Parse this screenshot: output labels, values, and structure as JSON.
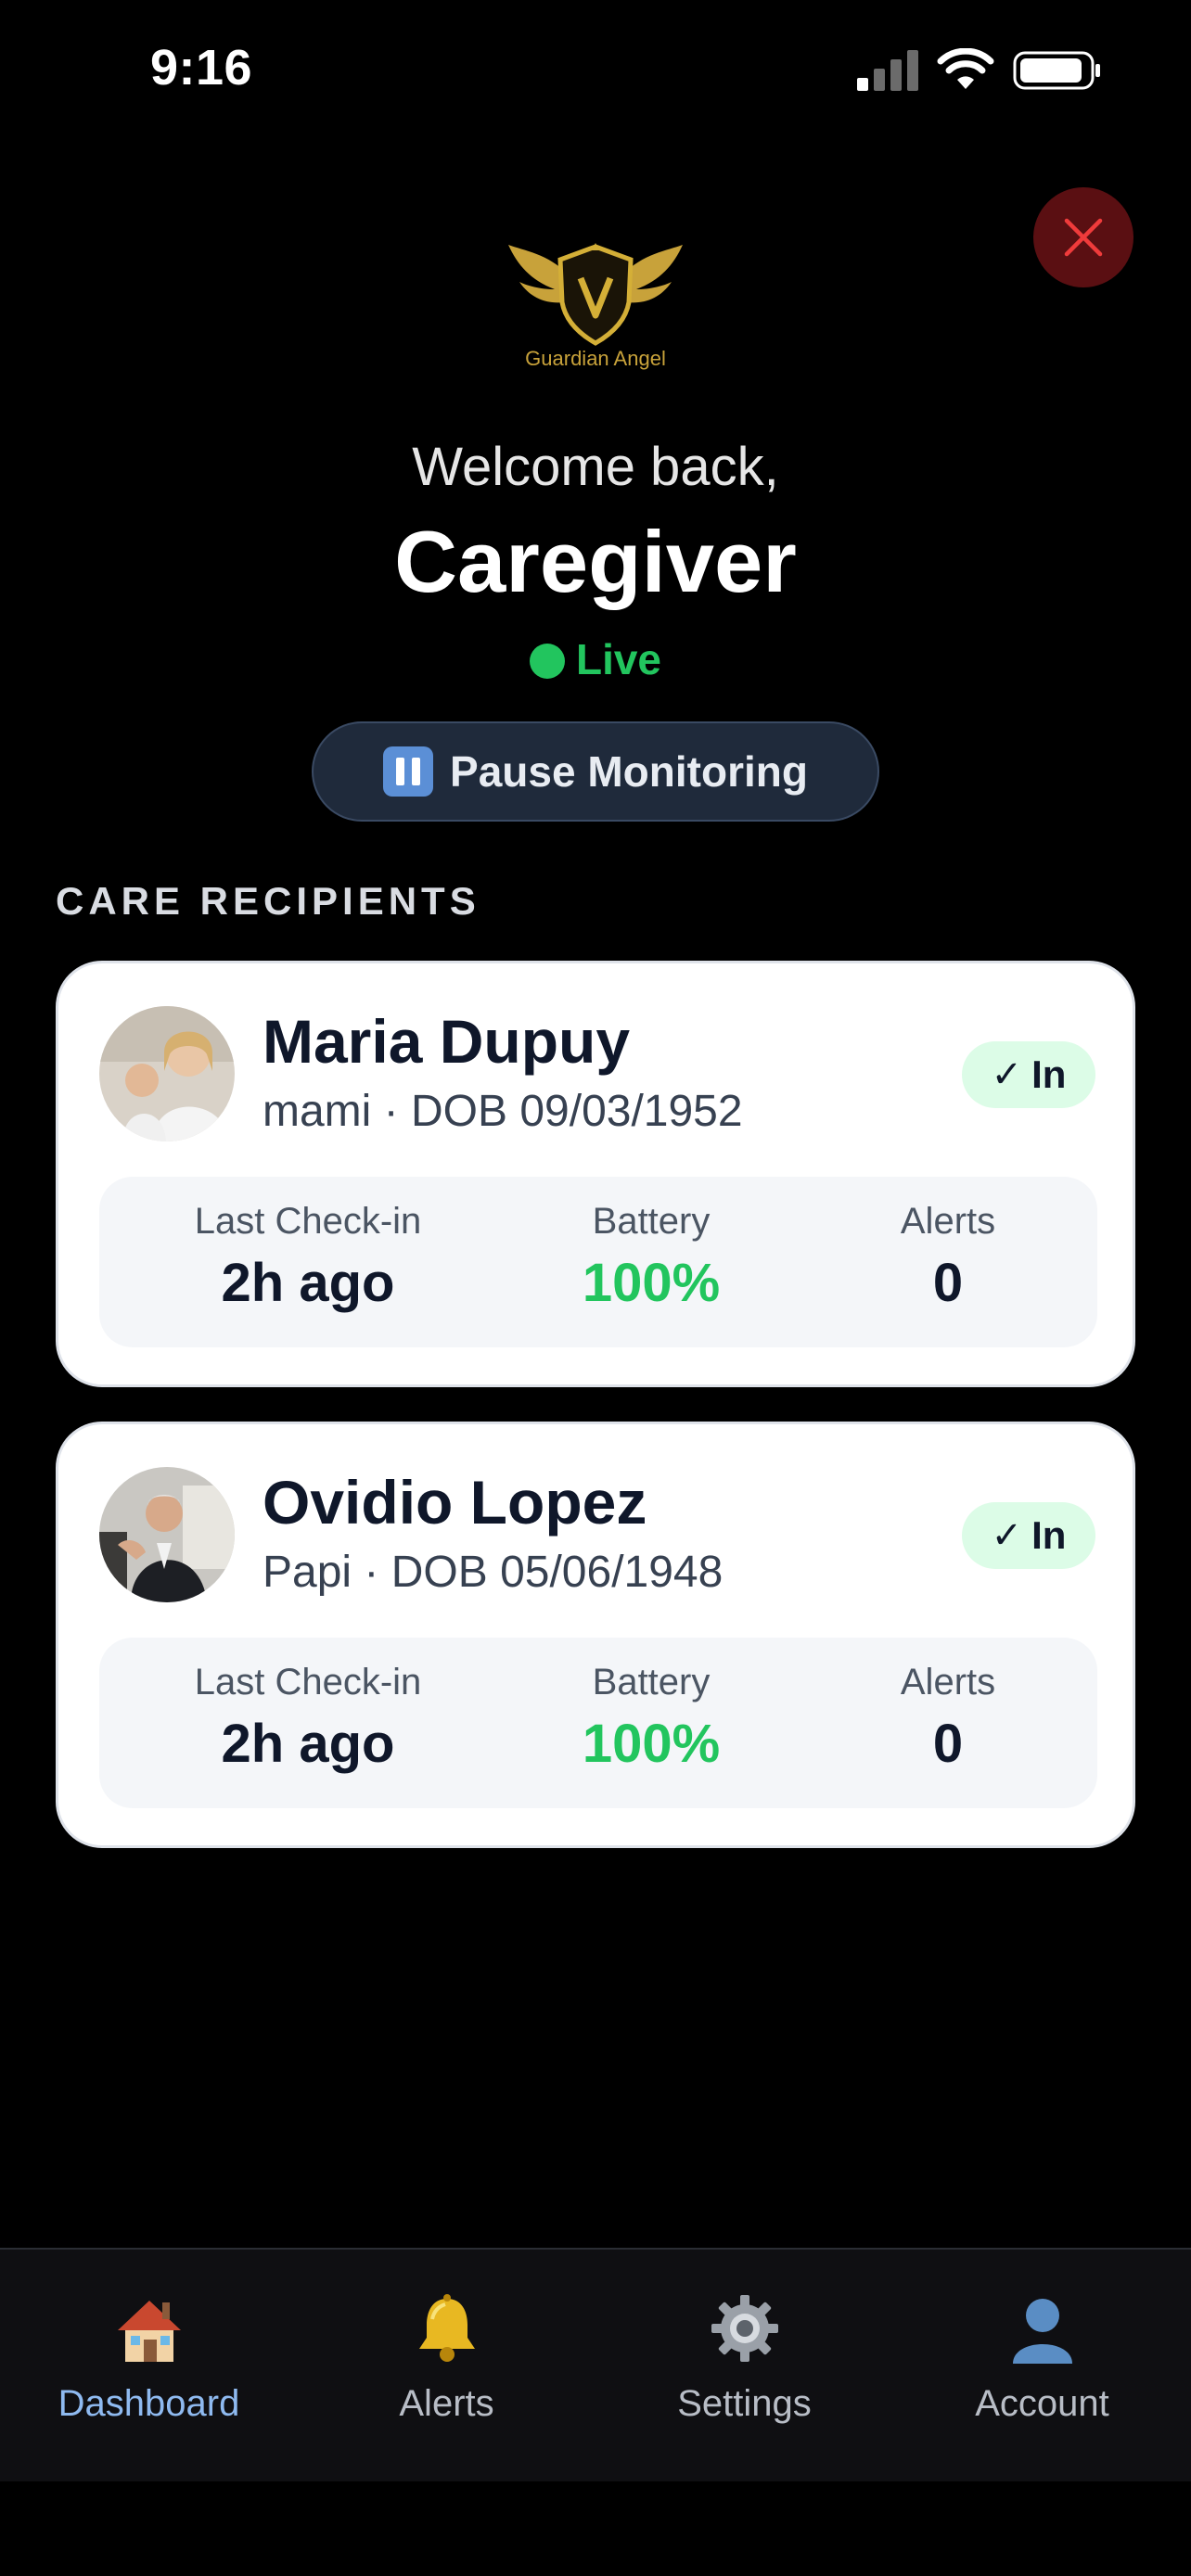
{
  "status_bar": {
    "time": "9:16"
  },
  "logo": {
    "text": "Guardian Angel",
    "icon": "winged-shield-logo"
  },
  "header": {
    "welcome": "Welcome back,",
    "user_name": "Caregiver",
    "live_status": "Live",
    "pause_button": "Pause Monitoring"
  },
  "section_title": "CARE RECIPIENTS",
  "recipients": [
    {
      "name": "Maria Dupuy",
      "subtitle": "mami · DOB 09/03/1952",
      "status": "In",
      "last_checkin_label": "Last Check-in",
      "last_checkin": "2h ago",
      "battery_label": "Battery",
      "battery": "100%",
      "alerts_label": "Alerts",
      "alerts": "0"
    },
    {
      "name": "Ovidio Lopez",
      "subtitle": "Papi · DOB 05/06/1948",
      "status": "In",
      "last_checkin_label": "Last Check-in",
      "last_checkin": "2h ago",
      "battery_label": "Battery",
      "battery": "100%",
      "alerts_label": "Alerts",
      "alerts": "0"
    }
  ],
  "tabs": [
    {
      "label": "Dashboard",
      "icon": "house-icon",
      "active": true
    },
    {
      "label": "Alerts",
      "icon": "bell-icon",
      "active": false
    },
    {
      "label": "Settings",
      "icon": "gear-icon",
      "active": false
    },
    {
      "label": "Account",
      "icon": "person-icon",
      "active": false
    }
  ],
  "colors": {
    "background": "#000000",
    "live_green": "#22c55e",
    "close_red": "#5a0f12",
    "active_tab": "#8fbaf0",
    "logo_gold": "#c8a23a"
  }
}
